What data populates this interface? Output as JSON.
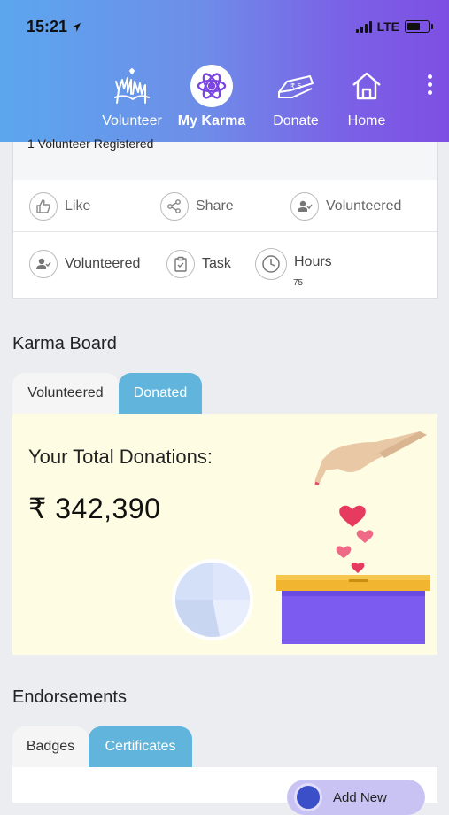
{
  "status": {
    "time": "15:21",
    "network": "LTE"
  },
  "nav": {
    "items": [
      {
        "label": "Volunteer",
        "icon": "volunteer-hands-icon"
      },
      {
        "label": "My Karma",
        "icon": "atom-karma-icon",
        "active": true
      },
      {
        "label": "Donate",
        "icon": "donate-hand-money-icon"
      },
      {
        "label": "Home",
        "icon": "home-icon"
      }
    ]
  },
  "card": {
    "registered_text": "1 Volunteer Registered",
    "actions_row1": [
      {
        "label": "Like",
        "icon": "thumbs-up-icon"
      },
      {
        "label": "Share",
        "icon": "share-icon"
      },
      {
        "label": "Volunteered",
        "icon": "user-check-icon"
      }
    ],
    "actions_row2": [
      {
        "label": "Volunteered",
        "icon": "user-check-icon"
      },
      {
        "label": "Task",
        "icon": "clipboard-check-icon"
      },
      {
        "label": "Hours",
        "icon": "clock-icon",
        "value": "75"
      }
    ]
  },
  "karma_board": {
    "title": "Karma Board",
    "tabs": [
      "Volunteered",
      "Donated"
    ],
    "active_tab": "Donated",
    "donations_label": "Your Total Donations:",
    "donations_amount": "₹ 342,390"
  },
  "endorsements": {
    "title": "Endorsements",
    "tabs": [
      "Badges",
      "Certificates"
    ],
    "active_tab": "Certificates",
    "add_button_label": "Add New"
  },
  "colors": {
    "header_start": "#5ba7ee",
    "header_end": "#7e4fe3",
    "tab_active": "#61b5dc",
    "donation_bg": "#fefde3",
    "box_purple": "#7c5cf0",
    "box_lid": "#f5b731"
  }
}
